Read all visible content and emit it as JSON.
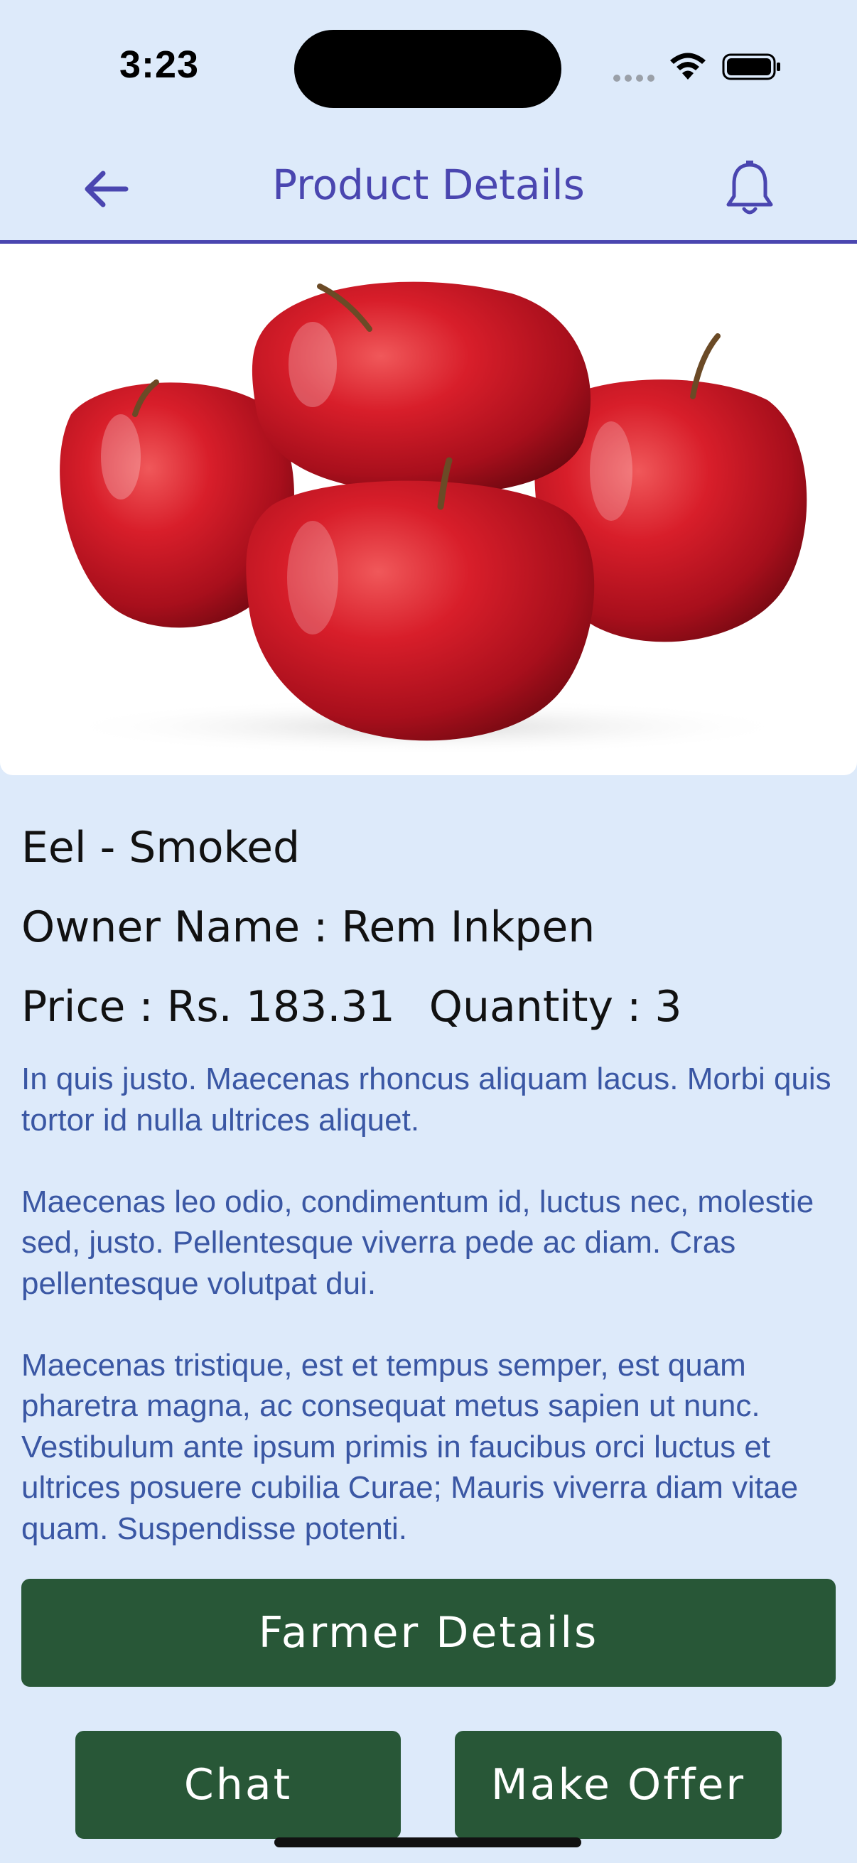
{
  "status_bar": {
    "time": "3:23"
  },
  "header": {
    "title": "Product Details",
    "back_icon": "arrow-left-icon",
    "notification_icon": "bell-icon"
  },
  "product": {
    "image_alt": "apples",
    "name": "Eel - Smoked",
    "owner_label": "Owner Name : ",
    "owner_name": "Rem Inkpen",
    "price_label": "Price : ",
    "price_value": "Rs. 183.31",
    "quantity_label": "Quantity : ",
    "quantity_value": "3",
    "description": [
      "In quis justo. Maecenas rhoncus aliquam lacus. Morbi quis tortor id nulla ultrices aliquet.",
      "Maecenas leo odio, condimentum id, luctus nec, molestie sed, justo. Pellentesque viverra pede ac diam. Cras pellentesque volutpat dui.",
      "Maecenas tristique, est et tempus semper, est quam pharetra magna, ac consequat metus sapien ut nunc. Vestibulum ante ipsum primis in faucibus orci luctus et ultrices posuere cubilia Curae; Mauris viverra diam vitae quam. Suspendisse potenti."
    ]
  },
  "actions": {
    "farmer_details": "Farmer Details",
    "chat": "Chat",
    "make_offer": "Make Offer"
  },
  "colors": {
    "background": "#ddeafa",
    "accent": "#4a46b0",
    "button": "#285737",
    "description_text": "#3a57a4"
  }
}
